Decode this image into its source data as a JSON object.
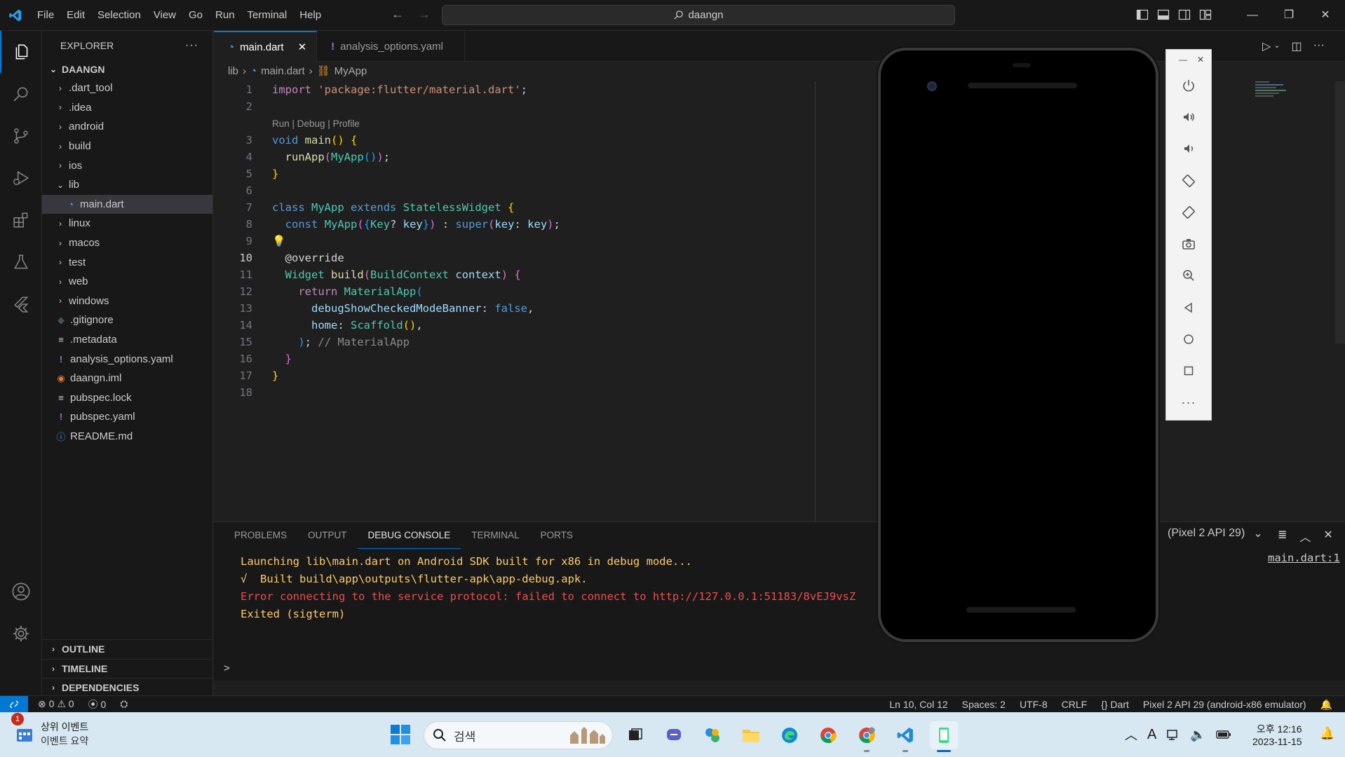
{
  "titlebar": {
    "menu": [
      "File",
      "Edit",
      "Selection",
      "View",
      "Go",
      "Run",
      "Terminal",
      "Help"
    ],
    "search": "daangn"
  },
  "sidebar": {
    "title": "EXPLORER",
    "root": "DAANGN",
    "items": [
      {
        "label": ".dart_tool",
        "type": "folder"
      },
      {
        "label": ".idea",
        "type": "folder"
      },
      {
        "label": "android",
        "type": "folder"
      },
      {
        "label": "build",
        "type": "folder"
      },
      {
        "label": "ios",
        "type": "folder"
      },
      {
        "label": "lib",
        "type": "folder-open"
      },
      {
        "label": "main.dart",
        "type": "dart"
      },
      {
        "label": "linux",
        "type": "folder"
      },
      {
        "label": "macos",
        "type": "folder"
      },
      {
        "label": "test",
        "type": "folder"
      },
      {
        "label": "web",
        "type": "folder"
      },
      {
        "label": "windows",
        "type": "folder"
      },
      {
        "label": ".gitignore",
        "type": "git"
      },
      {
        "label": ".metadata",
        "type": "text"
      },
      {
        "label": "analysis_options.yaml",
        "type": "yaml"
      },
      {
        "label": "daangn.iml",
        "type": "rss"
      },
      {
        "label": "pubspec.lock",
        "type": "text"
      },
      {
        "label": "pubspec.yaml",
        "type": "yaml"
      },
      {
        "label": "README.md",
        "type": "info"
      }
    ],
    "bottom_sections": [
      "OUTLINE",
      "TIMELINE",
      "DEPENDENCIES"
    ]
  },
  "tabs": [
    {
      "label": "main.dart",
      "active": true
    },
    {
      "label": "analysis_options.yaml",
      "active": false
    }
  ],
  "breadcrumb": {
    "folder": "lib",
    "file": "main.dart",
    "symbol": "MyApp"
  },
  "codelens": "Run | Debug | Profile",
  "code_lines": [
    {
      "n": "1",
      "t": "import 'package:flutter/material.dart';"
    },
    {
      "n": "2",
      "t": ""
    },
    {
      "n": "3",
      "t": "void main() {"
    },
    {
      "n": "4",
      "t": "  runApp(MyApp());"
    },
    {
      "n": "5",
      "t": "}"
    },
    {
      "n": "6",
      "t": ""
    },
    {
      "n": "7",
      "t": "class MyApp extends StatelessWidget {"
    },
    {
      "n": "8",
      "t": "  const MyApp({Key? key}) : super(key: key);"
    },
    {
      "n": "9",
      "t": ""
    },
    {
      "n": "10",
      "t": "  @override"
    },
    {
      "n": "11",
      "t": "  Widget build(BuildContext context) {"
    },
    {
      "n": "12",
      "t": "    return MaterialApp("
    },
    {
      "n": "13",
      "t": "      debugShowCheckedModeBanner: false,"
    },
    {
      "n": "14",
      "t": "      home: Scaffold(),"
    },
    {
      "n": "15",
      "t": "    ); // MaterialApp"
    },
    {
      "n": "16",
      "t": "  }"
    },
    {
      "n": "17",
      "t": "}"
    },
    {
      "n": "18",
      "t": ""
    }
  ],
  "panel": {
    "tabs": [
      "PROBLEMS",
      "OUTPUT",
      "DEBUG CONSOLE",
      "TERMINAL",
      "PORTS"
    ],
    "active_tab": "DEBUG CONSOLE",
    "device": "(Pixel 2 API 29)",
    "source_link": "main.dart:1",
    "lines": [
      "Launching lib\\main.dart on Android SDK built for x86 in debug mode...",
      "√  Built build\\app\\outputs\\flutter-apk\\app-debug.apk.",
      "Error connecting to the service protocol: failed to connect to http://127.0.0.1:51183/8vEJ9vsZ",
      "Exited (sigterm)"
    ],
    "prompt": ">"
  },
  "statusbar": {
    "errors": "0",
    "warnings": "0",
    "ports": "0",
    "position": "Ln 10, Col 12",
    "spaces": "Spaces: 2",
    "encoding": "UTF-8",
    "eol": "CRLF",
    "language": "Dart",
    "device": "Pixel 2 API 29 (android-x86 emulator)"
  },
  "taskbar": {
    "widget_title": "상위 이벤트",
    "widget_sub": "이벤트 요약",
    "badge": "1",
    "search_placeholder": "검색",
    "time": "오후 12:16",
    "date": "2023-11-15"
  },
  "colors": {
    "accent": "#0078d4",
    "error": "#f14c4c",
    "warning_text": "#ffcb6b"
  }
}
